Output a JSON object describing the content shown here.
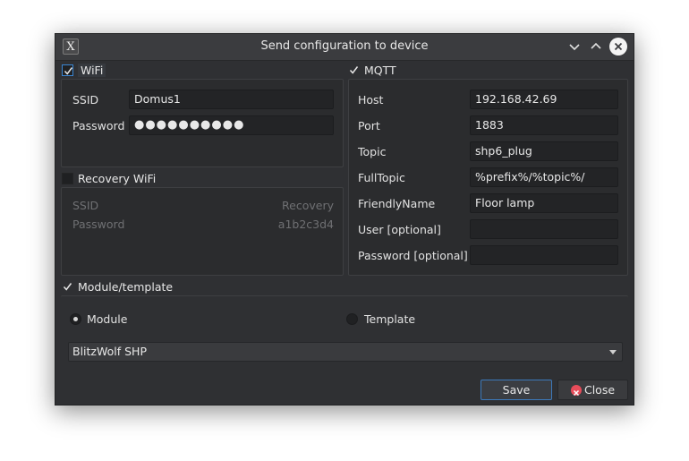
{
  "window": {
    "title": "Send configuration to device",
    "icon": "tdm-app-icon",
    "icon_glyph": "X"
  },
  "wifi": {
    "label": "WiFi",
    "checked": true,
    "ssid_label": "SSID",
    "ssid_value": "Domus1",
    "password_label": "Password",
    "password_value": "●●●●●●●●●●"
  },
  "recovery": {
    "label": "Recovery WiFi",
    "checked": false,
    "ssid_label": "SSID",
    "ssid_value": "Recovery",
    "password_label": "Password",
    "password_value": "a1b2c3d4"
  },
  "mqtt": {
    "label": "MQTT",
    "checked": true,
    "host_label": "Host",
    "host_value": "192.168.42.69",
    "port_label": "Port",
    "port_value": "1883",
    "topic_label": "Topic",
    "topic_value": "shp6_plug",
    "fulltopic_label": "FullTopic",
    "fulltopic_value": "%prefix%/%topic%/",
    "friendly_label": "FriendlyName",
    "friendly_value": "Floor lamp",
    "user_label": "User [optional]",
    "user_value": "",
    "password_label": "Password [optional]",
    "password_value": ""
  },
  "module": {
    "label": "Module/template",
    "checked": true,
    "radio_module": "Module",
    "radio_template": "Template",
    "selected": "Module",
    "dropdown_value": "BlitzWolf SHP"
  },
  "buttons": {
    "save": "Save",
    "close": "Close"
  },
  "colors": {
    "accent": "#3a86d3",
    "window_bg": "#2f3033",
    "close_icon": "#e74c5a"
  }
}
